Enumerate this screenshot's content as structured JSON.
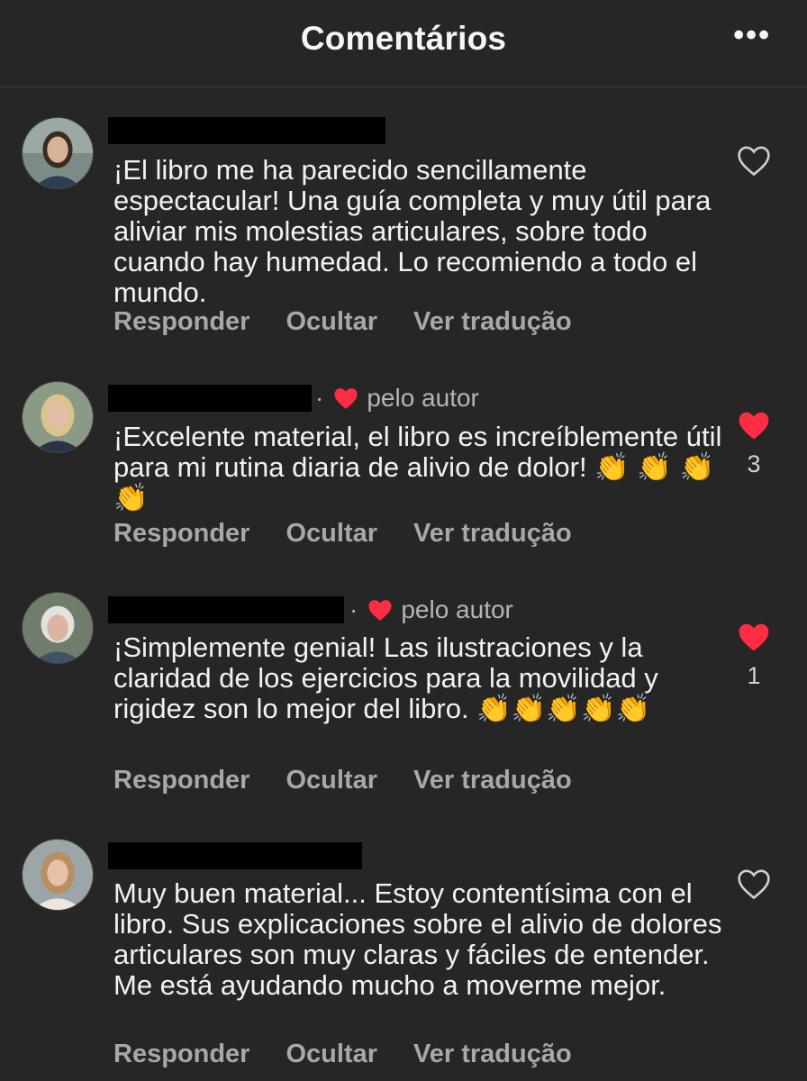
{
  "header": {
    "title": "Comentários",
    "more_icon": "more-horizontal-icon",
    "more_label": "•••"
  },
  "colors": {
    "background": "#262626",
    "like_red": "#ff2d44",
    "action_gray": "#a8a8a8"
  },
  "comments": [
    {
      "text": "¡El libro me ha parecido sencillamente espectacular! Una guía completa y muy útil para aliviar mis molestias articulares, sobre todo cuando hay humedad. Lo recomiendo a todo el mundo.",
      "liked_by_author": false,
      "author_badge": "",
      "liked": false,
      "like_count": "",
      "actions": {
        "reply": "Responder",
        "hide": "Ocultar",
        "translate": "Ver tradução"
      }
    },
    {
      "text": "¡Excelente material, el libro es increíblemente útil para mi rutina diaria de alivio de dolor! 👏 👏 👏 👏",
      "liked_by_author": true,
      "author_badge": "pelo autor",
      "badge_dot": "·",
      "liked": true,
      "like_count": "3",
      "actions": {
        "reply": "Responder",
        "hide": "Ocultar",
        "translate": "Ver tradução"
      }
    },
    {
      "text": "¡Simplemente genial! Las ilustraciones y la claridad de los ejercicios para la movilidad y rigidez son lo mejor del libro. 👏👏👏👏👏",
      "liked_by_author": true,
      "author_badge": "pelo autor",
      "badge_dot": "·",
      "liked": true,
      "like_count": "1",
      "actions": {
        "reply": "Responder",
        "hide": "Ocultar",
        "translate": "Ver tradução"
      }
    },
    {
      "text": "Muy buen material... Estoy contentísima con el libro. Sus explicaciones sobre el alivio de dolores articulares son muy claras y fáciles de entender. Me está ayudando mucho a moverme mejor.",
      "liked_by_author": false,
      "author_badge": "",
      "liked": false,
      "like_count": "",
      "actions": {
        "reply": "Responder",
        "hide": "Ocultar",
        "translate": "Ver tradução"
      }
    }
  ]
}
